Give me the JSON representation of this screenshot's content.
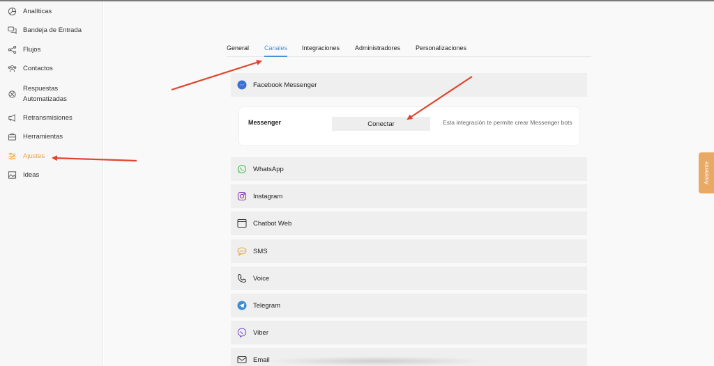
{
  "sidebar": {
    "items": [
      {
        "label": "Analíticas",
        "icon": "pie-chart-icon"
      },
      {
        "label": "Bandeja de Entrada",
        "icon": "chat-bubbles-icon"
      },
      {
        "label": "Flujos",
        "icon": "share-nodes-icon"
      },
      {
        "label": "Contactos",
        "icon": "contacts-icon"
      },
      {
        "label": "Respuestas",
        "label2": "Automatizadas",
        "icon": "auto-reply-icon"
      },
      {
        "label": "Retransmisiones",
        "icon": "megaphone-icon"
      },
      {
        "label": "Herramientas",
        "icon": "briefcase-icon"
      },
      {
        "label": "Ajustes",
        "icon": "sliders-icon",
        "active": true
      },
      {
        "label": "Ideas",
        "icon": "image-icon"
      }
    ]
  },
  "tabs": [
    {
      "label": "General"
    },
    {
      "label": "Canales",
      "active": true
    },
    {
      "label": "Integraciones"
    },
    {
      "label": "Administradores"
    },
    {
      "label": "Personalizaciones"
    }
  ],
  "channels": {
    "facebook": "Facebook Messenger",
    "whatsapp": "WhatsApp",
    "instagram": "Instagram",
    "chatbot": "Chatbot Web",
    "sms": "SMS",
    "voice": "Voice",
    "telegram": "Telegram",
    "viber": "Viber",
    "email": "Email"
  },
  "messenger_card": {
    "title": "Messenger",
    "button": "Conectar",
    "description": "Esta integración te permite crear Messenger bots"
  },
  "asistente": "Asistente",
  "colors": {
    "accent_active_tab": "#4a8fd8",
    "accent_active_nav": "#e8a24c",
    "annotation_arrow": "#e0442c",
    "assistant_tab": "#e9a864"
  }
}
